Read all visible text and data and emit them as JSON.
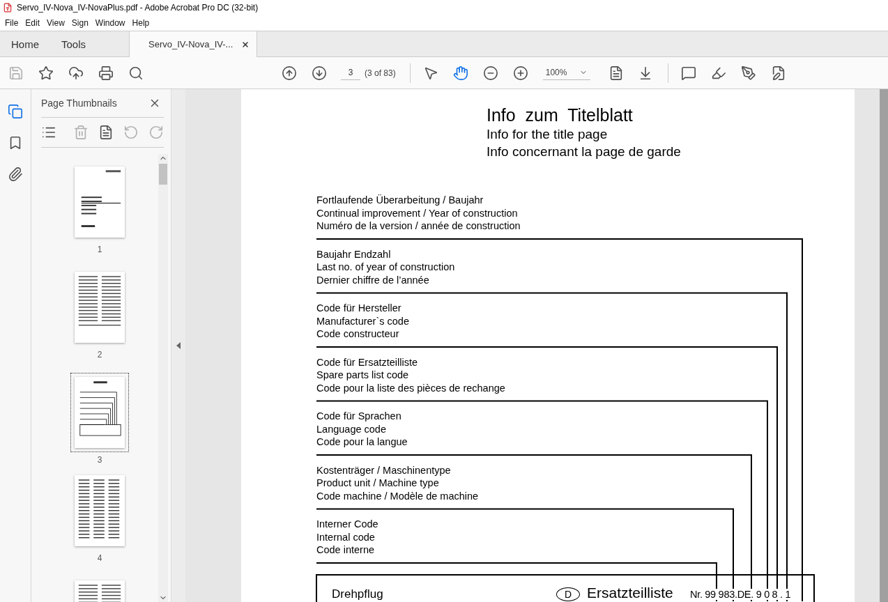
{
  "window": {
    "title": "Servo_IV-Nova_IV-NovaPlus.pdf - Adobe Acrobat Pro DC (32-bit)"
  },
  "menu": [
    "File",
    "Edit",
    "View",
    "Sign",
    "Window",
    "Help"
  ],
  "tabs": [
    {
      "label": "Home",
      "selected": false
    },
    {
      "label": "Tools",
      "selected": false
    },
    {
      "label": "Servo_IV-Nova_IV-...",
      "selected": true,
      "closable": true
    }
  ],
  "toolbar": {
    "page_field": "3",
    "page_count": "(3 of 83)",
    "zoom": "100%",
    "tools": [
      {
        "kind": "select",
        "selected": false
      },
      {
        "kind": "hand",
        "selected": true
      }
    ]
  },
  "rail": [
    {
      "kind": "thumbnails",
      "selected": true
    },
    {
      "kind": "bookmarks",
      "selected": false
    },
    {
      "kind": "attachments",
      "selected": false
    }
  ],
  "sidebar": {
    "title": "Page Thumbnails",
    "thumbnails": [
      {
        "label": "1",
        "selected": false,
        "kind": "cover"
      },
      {
        "label": "2",
        "selected": false,
        "kind": "text"
      },
      {
        "label": "3",
        "selected": true,
        "kind": "diagram"
      },
      {
        "label": "4",
        "selected": false,
        "kind": "list"
      },
      {
        "selected": false,
        "kind": "text"
      }
    ]
  },
  "document": {
    "title": "Info  zum  Titelblatt",
    "subtitles": [
      "Info for the title page",
      "Info concernant la page de garde"
    ],
    "groups": [
      {
        "lines": [
          "Fortlaufende Überarbeitung / Baujahr",
          "Continual improvement / Year of construction",
          "Numéro de la version / année de construction"
        ]
      },
      {
        "lines": [
          "Baujahr Endzahl",
          "Last no. of year of construction",
          "Dernier chiffre de l’année"
        ]
      },
      {
        "lines": [
          "Code für Hersteller",
          "Manufacturer`s  code",
          "Code constructeur"
        ]
      },
      {
        "lines": [
          "Code für Ersatzteilliste",
          "Spare parts list code",
          "Code pour la liste des pièces de rechange"
        ]
      },
      {
        "lines": [
          "Code für Sprachen",
          "Language code",
          "Code pour la langue"
        ]
      },
      {
        "lines": [
          "Kostenträger / Maschinentype",
          "Product unit / Machine type",
          "Code machine / Modèle de machine"
        ]
      },
      {
        "lines": [
          "Interner Code",
          "Internal code",
          "Code interne"
        ]
      }
    ],
    "footer": {
      "product": "Drehpflug",
      "language_badge": "D",
      "heading": "Ersatzteilliste",
      "number": "Nr. 99 983.DE. 9 0 8 . 1"
    }
  }
}
